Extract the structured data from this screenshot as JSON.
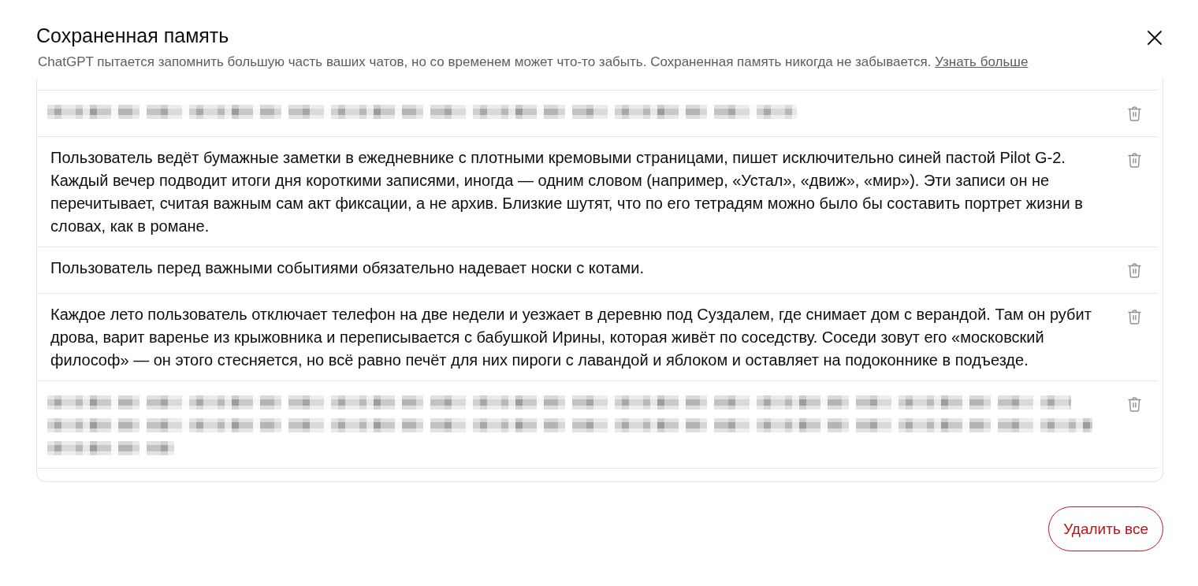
{
  "dialog": {
    "title": "Сохраненная память",
    "description": "ChatGPT пытается запомнить большую часть ваших чатов, но со временем может что-то забыть. Сохраненная память никогда не забывается.",
    "learn_more_link": "Узнать больше"
  },
  "memories": [
    {
      "kind": "redacted",
      "long": false
    },
    {
      "kind": "text",
      "text": "Пользователь ведёт бумажные заметки в ежедневнике с плотными кремовыми страницами, пишет исключительно синей пастой Pilot G-2. Каждый вечер подводит итоги дня короткими записями, иногда — одним словом (например, «Устал», «движ», «мир»). Эти записи он не перечитывает, считая важным сам акт фиксации, а не архив. Близкие шутят, что по его тетрадям можно было бы составить портрет жизни в словах, как в романе."
    },
    {
      "kind": "text",
      "text": "Пользователь перед важными событиями обязательно надевает носки с котами."
    },
    {
      "kind": "text",
      "text": "Каждое лето пользователь отключает телефон на две недели и уезжает в деревню под Суздалем, где снимает дом с верандой. Там он рубит дрова, варит варенье из крыжовника и переписывается с бабушкой Ирины, которая живёт по соседству. Соседи зовут его «московский философ» — он этого стесняется, но всё равно печёт для них пироги с лавандой и яблоком и оставляет на подоконнике в подъезде."
    },
    {
      "kind": "redacted",
      "long": true
    }
  ],
  "delete_all_button": "Удалить все"
}
